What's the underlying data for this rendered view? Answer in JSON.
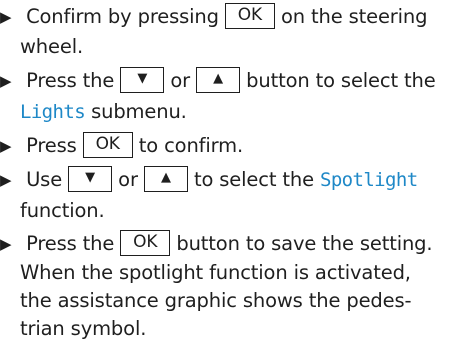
{
  "marker": "▶",
  "keys": {
    "ok": "OK",
    "down": "▼",
    "up": "▲"
  },
  "steps": [
    {
      "line1": {
        "a": "Confirm by pressing",
        "b": "on the steering"
      },
      "line2": "wheel."
    },
    {
      "line1": {
        "a": "Press the",
        "b": "or",
        "c": "button to select the"
      },
      "line2": {
        "submenu": "Lights",
        "rest": "submenu."
      }
    },
    {
      "line1": {
        "a": "Press",
        "b": "to confirm."
      }
    },
    {
      "line1": {
        "a": "Use",
        "b": "or",
        "c": "to select the",
        "function": "Spotlight"
      },
      "line2": "function."
    },
    {
      "line1": {
        "a": "Press the",
        "b": "button to save the setting."
      },
      "line2": "When the spotlight function is activated,",
      "line3": "the assistance graphic shows the pedes-",
      "line4": "trian symbol."
    }
  ],
  "colors": {
    "text": "#1f1f1f",
    "display_text": "#1e88c7"
  }
}
